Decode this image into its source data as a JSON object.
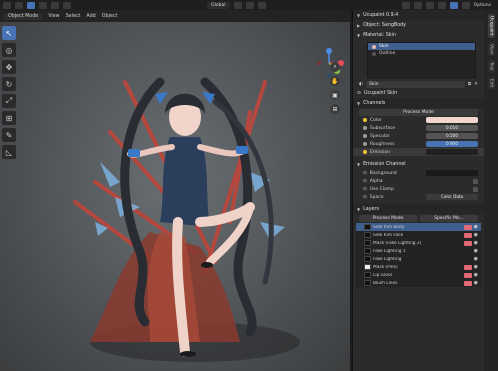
{
  "topbar": {
    "view_label": "Global",
    "options_label": "Options"
  },
  "header": {
    "mode": "Object Mode",
    "menu": [
      "View",
      "Select",
      "Add",
      "Object"
    ]
  },
  "tools": [
    {
      "name": "select-tool",
      "glyph": "↖",
      "active": true
    },
    {
      "name": "cursor-tool",
      "glyph": "◎",
      "active": false
    },
    {
      "name": "move-tool",
      "glyph": "✥",
      "active": false
    },
    {
      "name": "rotate-tool",
      "glyph": "↻",
      "active": false
    },
    {
      "name": "scale-tool",
      "glyph": "⤢",
      "active": false
    },
    {
      "name": "transform-tool",
      "glyph": "⊞",
      "active": false
    },
    {
      "name": "annotate-tool",
      "glyph": "✎",
      "active": false
    },
    {
      "name": "measure-tool",
      "glyph": "📐",
      "active": false
    }
  ],
  "gizmo": {
    "x_color": "#e74c5a",
    "y_color": "#8bc34a",
    "z_color": "#4c8fe7"
  },
  "panel": {
    "title": "Ucupaint 0.9.4",
    "object_label": "Object: SangBody",
    "material_label": "Material: Skin",
    "material_list": [
      "Skin",
      "Outline"
    ],
    "material_field": "Skin",
    "ucupaint_node_label": "Ucupaint Skin",
    "channels_label": "Channels",
    "process_mode_label": "Process Mode",
    "color_label": "Color",
    "color_value": "#f0d6cc",
    "subsurface_label": "Subsurface",
    "subsurface_value": "0.010",
    "specular_label": "Specular",
    "specular_value": "0.500",
    "roughness_label": "Roughness",
    "roughness_value": "0.900",
    "emission_label": "Emission",
    "emission_value": "#202020",
    "emission_channel_label": "Emission Channel",
    "background_label": "Background",
    "alpha_label": "Alpha",
    "use_clamp_label": "Use Clamp",
    "space_label": "Space",
    "space_value": "Color Data",
    "layers_label": "Layers",
    "layers_col1": "Process Mode",
    "layers_col2": "Specific Mo...",
    "layers": [
      {
        "name": "Side Rim Body",
        "selected": true
      },
      {
        "name": "Side Rim Face",
        "selected": false
      },
      {
        "name": "Mask (Fake Lighting 2)",
        "selected": false
      },
      {
        "name": "Fake Lighting 1",
        "selected": false
      },
      {
        "name": "Fake Lighting",
        "selected": false
      },
      {
        "name": "Mask (Pink)",
        "selected": false
      },
      {
        "name": "Lip Gloss",
        "selected": false
      },
      {
        "name": "Blush Lines",
        "selected": false
      }
    ]
  },
  "side_tabs": [
    "Ucupaint",
    "View",
    "Tool",
    "Edit"
  ],
  "figure": {
    "hair_color": "#2a2c33",
    "dress_color": "#2b3f5c",
    "accent_color": "#c0392b",
    "ribbon_color": "#3a78c8"
  }
}
